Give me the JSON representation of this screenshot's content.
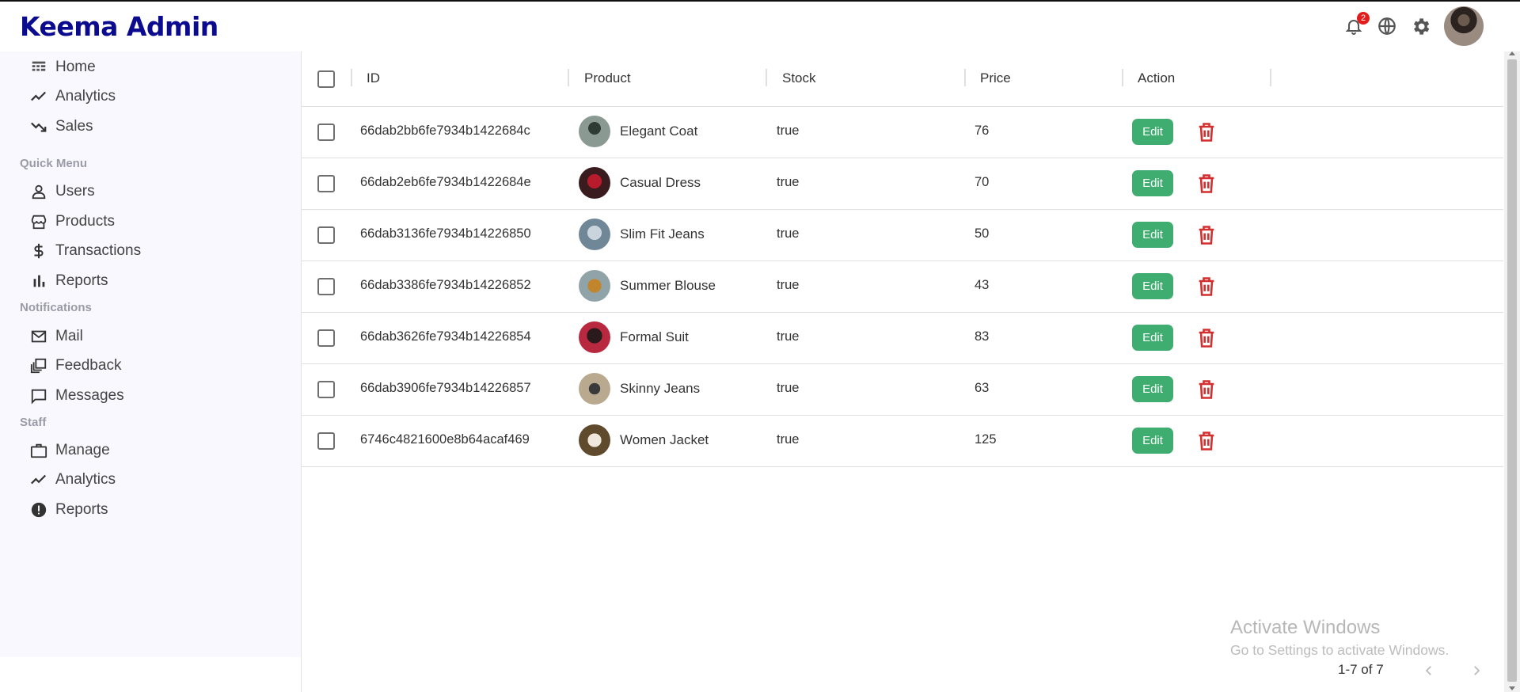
{
  "app": {
    "title": "Keema Admin"
  },
  "topbar": {
    "notification_count": "2",
    "icons": [
      "bell-icon",
      "globe-icon",
      "gear-icon",
      "avatar"
    ]
  },
  "sidebar": {
    "main_items": [
      {
        "label": "Home",
        "icon": "home-icon"
      },
      {
        "label": "Analytics",
        "icon": "trend-up-icon"
      },
      {
        "label": "Sales",
        "icon": "trend-down-icon"
      }
    ],
    "quick_menu_title": "Quick Menu",
    "quick_menu_items": [
      {
        "label": "Users",
        "icon": "user-icon"
      },
      {
        "label": "Products",
        "icon": "store-icon"
      },
      {
        "label": "Transactions",
        "icon": "dollar-icon"
      },
      {
        "label": "Reports",
        "icon": "bar-chart-icon"
      }
    ],
    "notifications_title": "Notifications",
    "notifications_items": [
      {
        "label": "Mail",
        "icon": "mail-icon"
      },
      {
        "label": "Feedback",
        "icon": "feedback-icon"
      },
      {
        "label": "Messages",
        "icon": "chat-icon"
      }
    ],
    "staff_title": "Staff",
    "staff_items": [
      {
        "label": "Manage",
        "icon": "briefcase-icon"
      },
      {
        "label": "Analytics",
        "icon": "trend-up-icon"
      },
      {
        "label": "Reports",
        "icon": "alert-icon"
      }
    ]
  },
  "table": {
    "columns": [
      "ID",
      "Product",
      "Stock",
      "Price",
      "Action"
    ],
    "edit_label": "Edit",
    "rows": [
      {
        "id": "66dab2bb6fe7934b1422684c",
        "product": "Elegant Coat",
        "stock": "true",
        "price": "76"
      },
      {
        "id": "66dab2eb6fe7934b1422684e",
        "product": "Casual Dress",
        "stock": "true",
        "price": "70"
      },
      {
        "id": "66dab3136fe7934b14226850",
        "product": "Slim Fit Jeans",
        "stock": "true",
        "price": "50"
      },
      {
        "id": "66dab3386fe7934b14226852",
        "product": "Summer Blouse",
        "stock": "true",
        "price": "43"
      },
      {
        "id": "66dab3626fe7934b14226854",
        "product": "Formal Suit",
        "stock": "true",
        "price": "83"
      },
      {
        "id": "66dab3906fe7934b14226857",
        "product": "Skinny Jeans",
        "stock": "true",
        "price": "63"
      },
      {
        "id": "6746c4821600e8b64acaf469",
        "product": "Women Jacket",
        "stock": "true",
        "price": "125"
      }
    ]
  },
  "pagination": {
    "text": "1-7 of 7"
  },
  "watermark": {
    "line1": "Activate Windows",
    "line2": "Go to Settings to activate Windows."
  },
  "colors": {
    "brand": "#0b0b8f",
    "edit": "#3fad6f",
    "delete": "#d32f2f",
    "badge": "#e21b1b",
    "sidebar_bg": "#f8f8fe"
  }
}
